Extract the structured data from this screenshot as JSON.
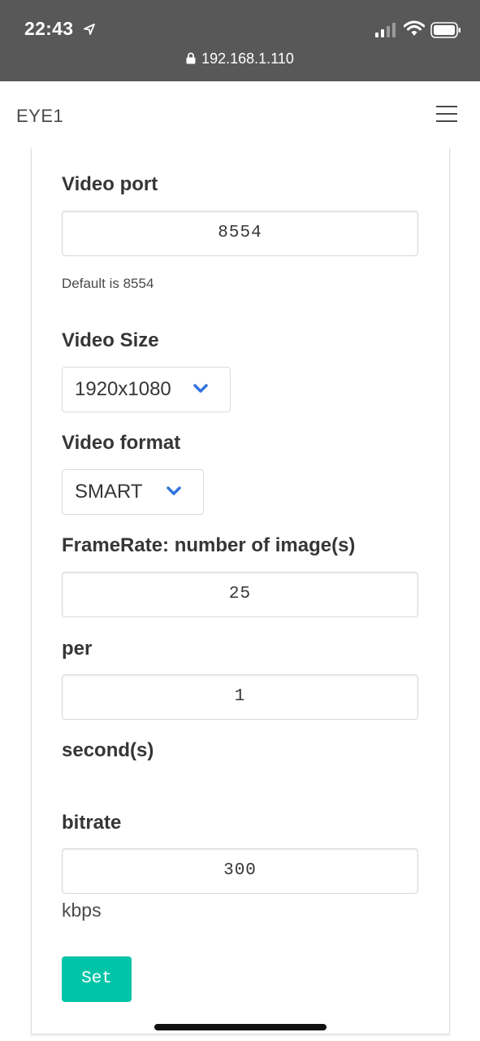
{
  "status_bar": {
    "time": "22:43",
    "url": "192.168.1.110"
  },
  "navbar": {
    "brand": "EYE1"
  },
  "form": {
    "video_port": {
      "label": "Video port",
      "value": "8554",
      "help": "Default is 8554"
    },
    "video_size": {
      "label": "Video Size",
      "selected": "1920x1080"
    },
    "video_format": {
      "label": "Video format",
      "selected": "SMART"
    },
    "framerate": {
      "label": "FrameRate: number of image(s)",
      "value": "25"
    },
    "per": {
      "label": "per",
      "value": "1"
    },
    "seconds_label": "second(s)",
    "bitrate": {
      "label": "bitrate",
      "value": "300",
      "unit": "kbps"
    },
    "set_label": "Set"
  },
  "colors": {
    "status_bar_bg": "#585858",
    "button_primary": "#00c4a7",
    "chevron": "#3273dc"
  },
  "icons": [
    "location-arrow-icon",
    "signal-icon",
    "wifi-icon",
    "battery-icon",
    "lock-icon",
    "hamburger-menu-icon",
    "chevron-down-icon"
  ]
}
